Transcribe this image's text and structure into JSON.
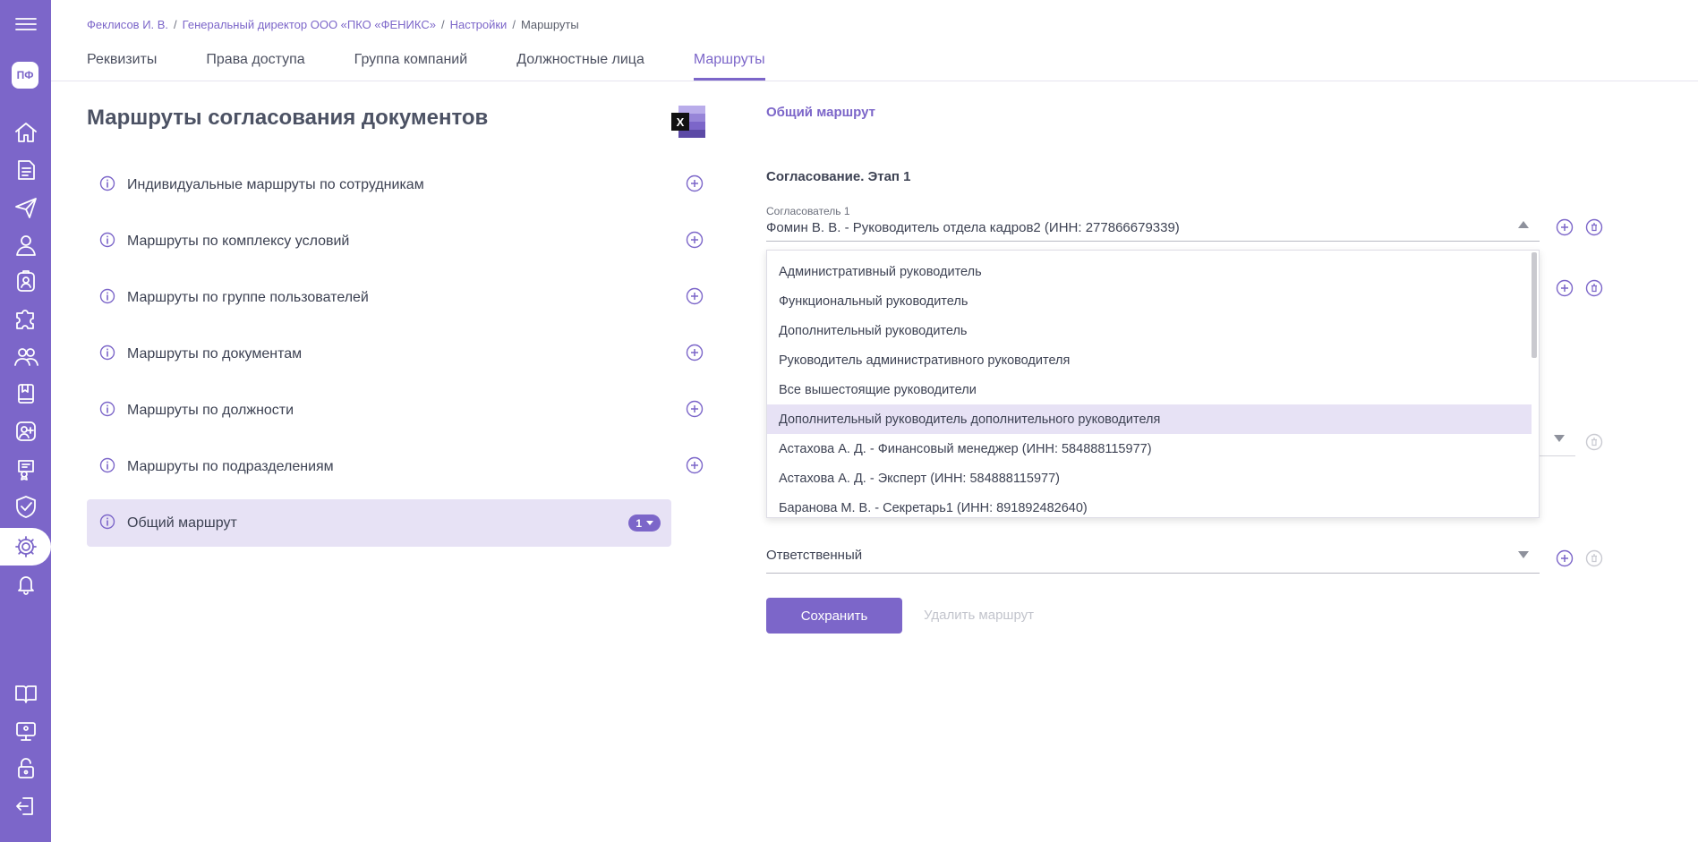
{
  "sidebar": {
    "avatar_initials": "ПФ",
    "items": [
      "menu-icon",
      "home-icon",
      "document-icon",
      "send-icon",
      "user-icon",
      "badge-icon",
      "puzzle-icon",
      "users-icon",
      "book-icon",
      "add-user-icon",
      "certificate-icon",
      "shield-check-icon",
      "gear-icon",
      "bell-icon",
      "manual-icon",
      "presentation-icon",
      "lock-icon",
      "logout-icon"
    ],
    "accent": "#7c66c9"
  },
  "breadcrumbs": {
    "items": [
      "Феклисов И. В.",
      "Генеральный директор ООО «ПКО «ФЕНИКС»",
      "Настройки"
    ],
    "separator": "/",
    "current": "Маршруты"
  },
  "tabs": [
    {
      "label": "Реквизиты",
      "active": false
    },
    {
      "label": "Права доступа",
      "active": false
    },
    {
      "label": "Группа компаний",
      "active": false
    },
    {
      "label": "Должностные лица",
      "active": false
    },
    {
      "label": "Маршруты",
      "active": true
    }
  ],
  "page_title": "Маршруты согласования документов",
  "excel_label": "X",
  "routes": [
    {
      "label": "Индивидуальные маршруты по сотрудникам"
    },
    {
      "label": "Маршруты по комплексу условий"
    },
    {
      "label": "Маршруты по группе пользователей"
    },
    {
      "label": "Маршруты по документам"
    },
    {
      "label": "Маршруты по должности"
    },
    {
      "label": "Маршруты по подразделениям"
    },
    {
      "label": "Общий маршрут",
      "badge": "1",
      "selected": true
    }
  ],
  "detail": {
    "route_title": "Общий маршрут",
    "stage_title": "Согласование. Этап 1",
    "approver_label": "Согласователь 1",
    "approver_value": "Фомин В. В. - Руководитель отдела кадров2 (ИНН: 277866679339)",
    "responsible_placeholder": "Ответственный"
  },
  "dropdown_options": [
    "Административный руководитель",
    "Функциональный руководитель",
    "Дополнительный руководитель",
    "Руководитель административного руководителя",
    "Все вышестоящие руководители",
    "Дополнительный руководитель дополнительного руководителя",
    "Астахова А. Д. - Финансовый менеджер (ИНН: 584888115977)",
    "Астахова А. Д. - Эксперт (ИНН: 584888115977)",
    "Баранова М. В. - Секретарь1 (ИНН: 891892482640)"
  ],
  "dropdown_highlight_index": 5,
  "buttons": {
    "save": "Сохранить",
    "delete": "Удалить маршрут"
  }
}
